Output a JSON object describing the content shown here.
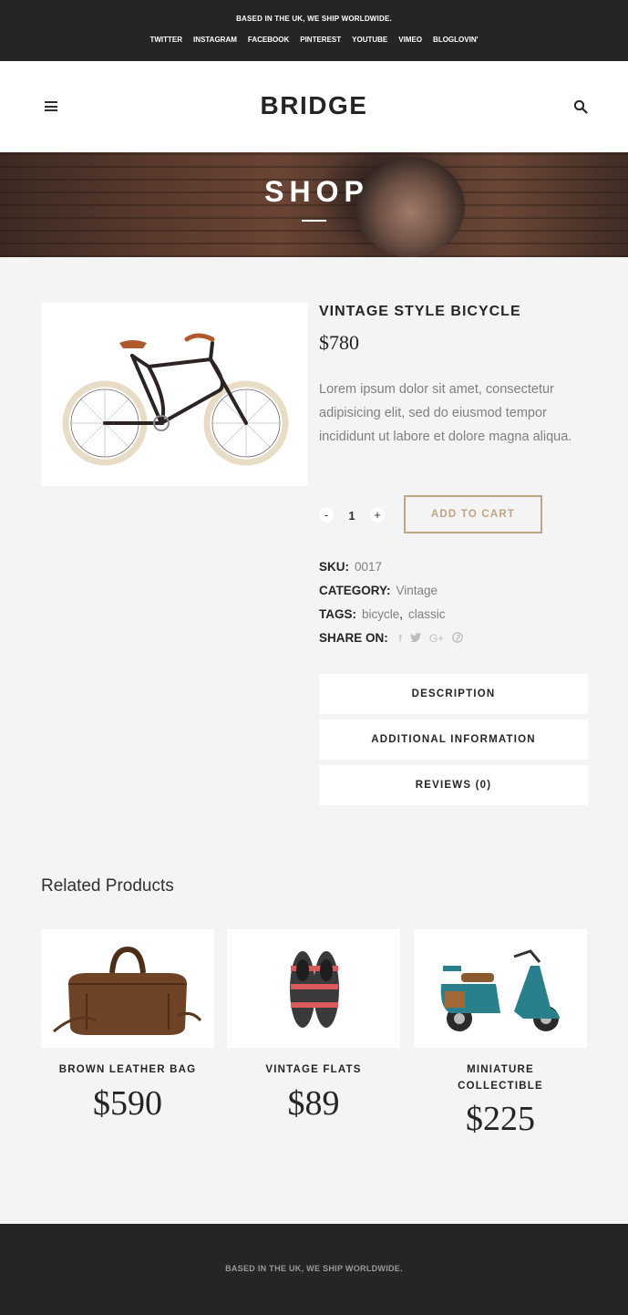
{
  "topbar": {
    "shipping": "BASED IN THE UK, WE SHIP WORLDWIDE.",
    "social": [
      "TWITTER",
      "INSTAGRAM",
      "FACEBOOK",
      "PINTEREST",
      "YOUTUBE",
      "VIMEO",
      "BLOGLOVIN'"
    ]
  },
  "header": {
    "logo": "BRIDGE",
    "menu_icon": "hamburger-icon",
    "search_icon": "search-icon"
  },
  "hero": {
    "title": "SHOP"
  },
  "product": {
    "title": "VINTAGE STYLE BICYCLE",
    "price": "$780",
    "description": "Lorem ipsum dolor sit amet, consectetur adipisicing elit, sed do eiusmod tempor incididunt ut labore et dolore magna aliqua.",
    "quantity": "1",
    "qty_minus": "-",
    "qty_plus": "+",
    "add_to_cart": "ADD TO CART",
    "sku_label": "SKU:",
    "sku": "0017",
    "category_label": "CATEGORY:",
    "category": "Vintage",
    "tags_label": "TAGS:",
    "tags": [
      "bicycle",
      "classic"
    ],
    "tag_separator": ",",
    "share_label": "SHARE ON:",
    "share_icons": [
      "facebook-icon",
      "twitter-icon",
      "google-plus-icon",
      "pinterest-icon"
    ]
  },
  "tabs": [
    "DESCRIPTION",
    "ADDITIONAL INFORMATION",
    "REVIEWS (0)"
  ],
  "related": {
    "title": "Related Products",
    "items": [
      {
        "name": "BROWN LEATHER BAG",
        "price": "$590"
      },
      {
        "name": "VINTAGE FLATS",
        "price": "$89"
      },
      {
        "name": "MINIATURE COLLECTIBLE",
        "name_line1": "MINIATURE",
        "name_line2": "COLLECTIBLE",
        "price": "$225"
      }
    ]
  },
  "footer": {
    "shipping": "BASED IN THE UK, WE SHIP WORLDWIDE."
  },
  "colors": {
    "dark": "#252525",
    "accent": "#c2a383",
    "background": "#f4f4f4",
    "muted_text": "#808080"
  }
}
